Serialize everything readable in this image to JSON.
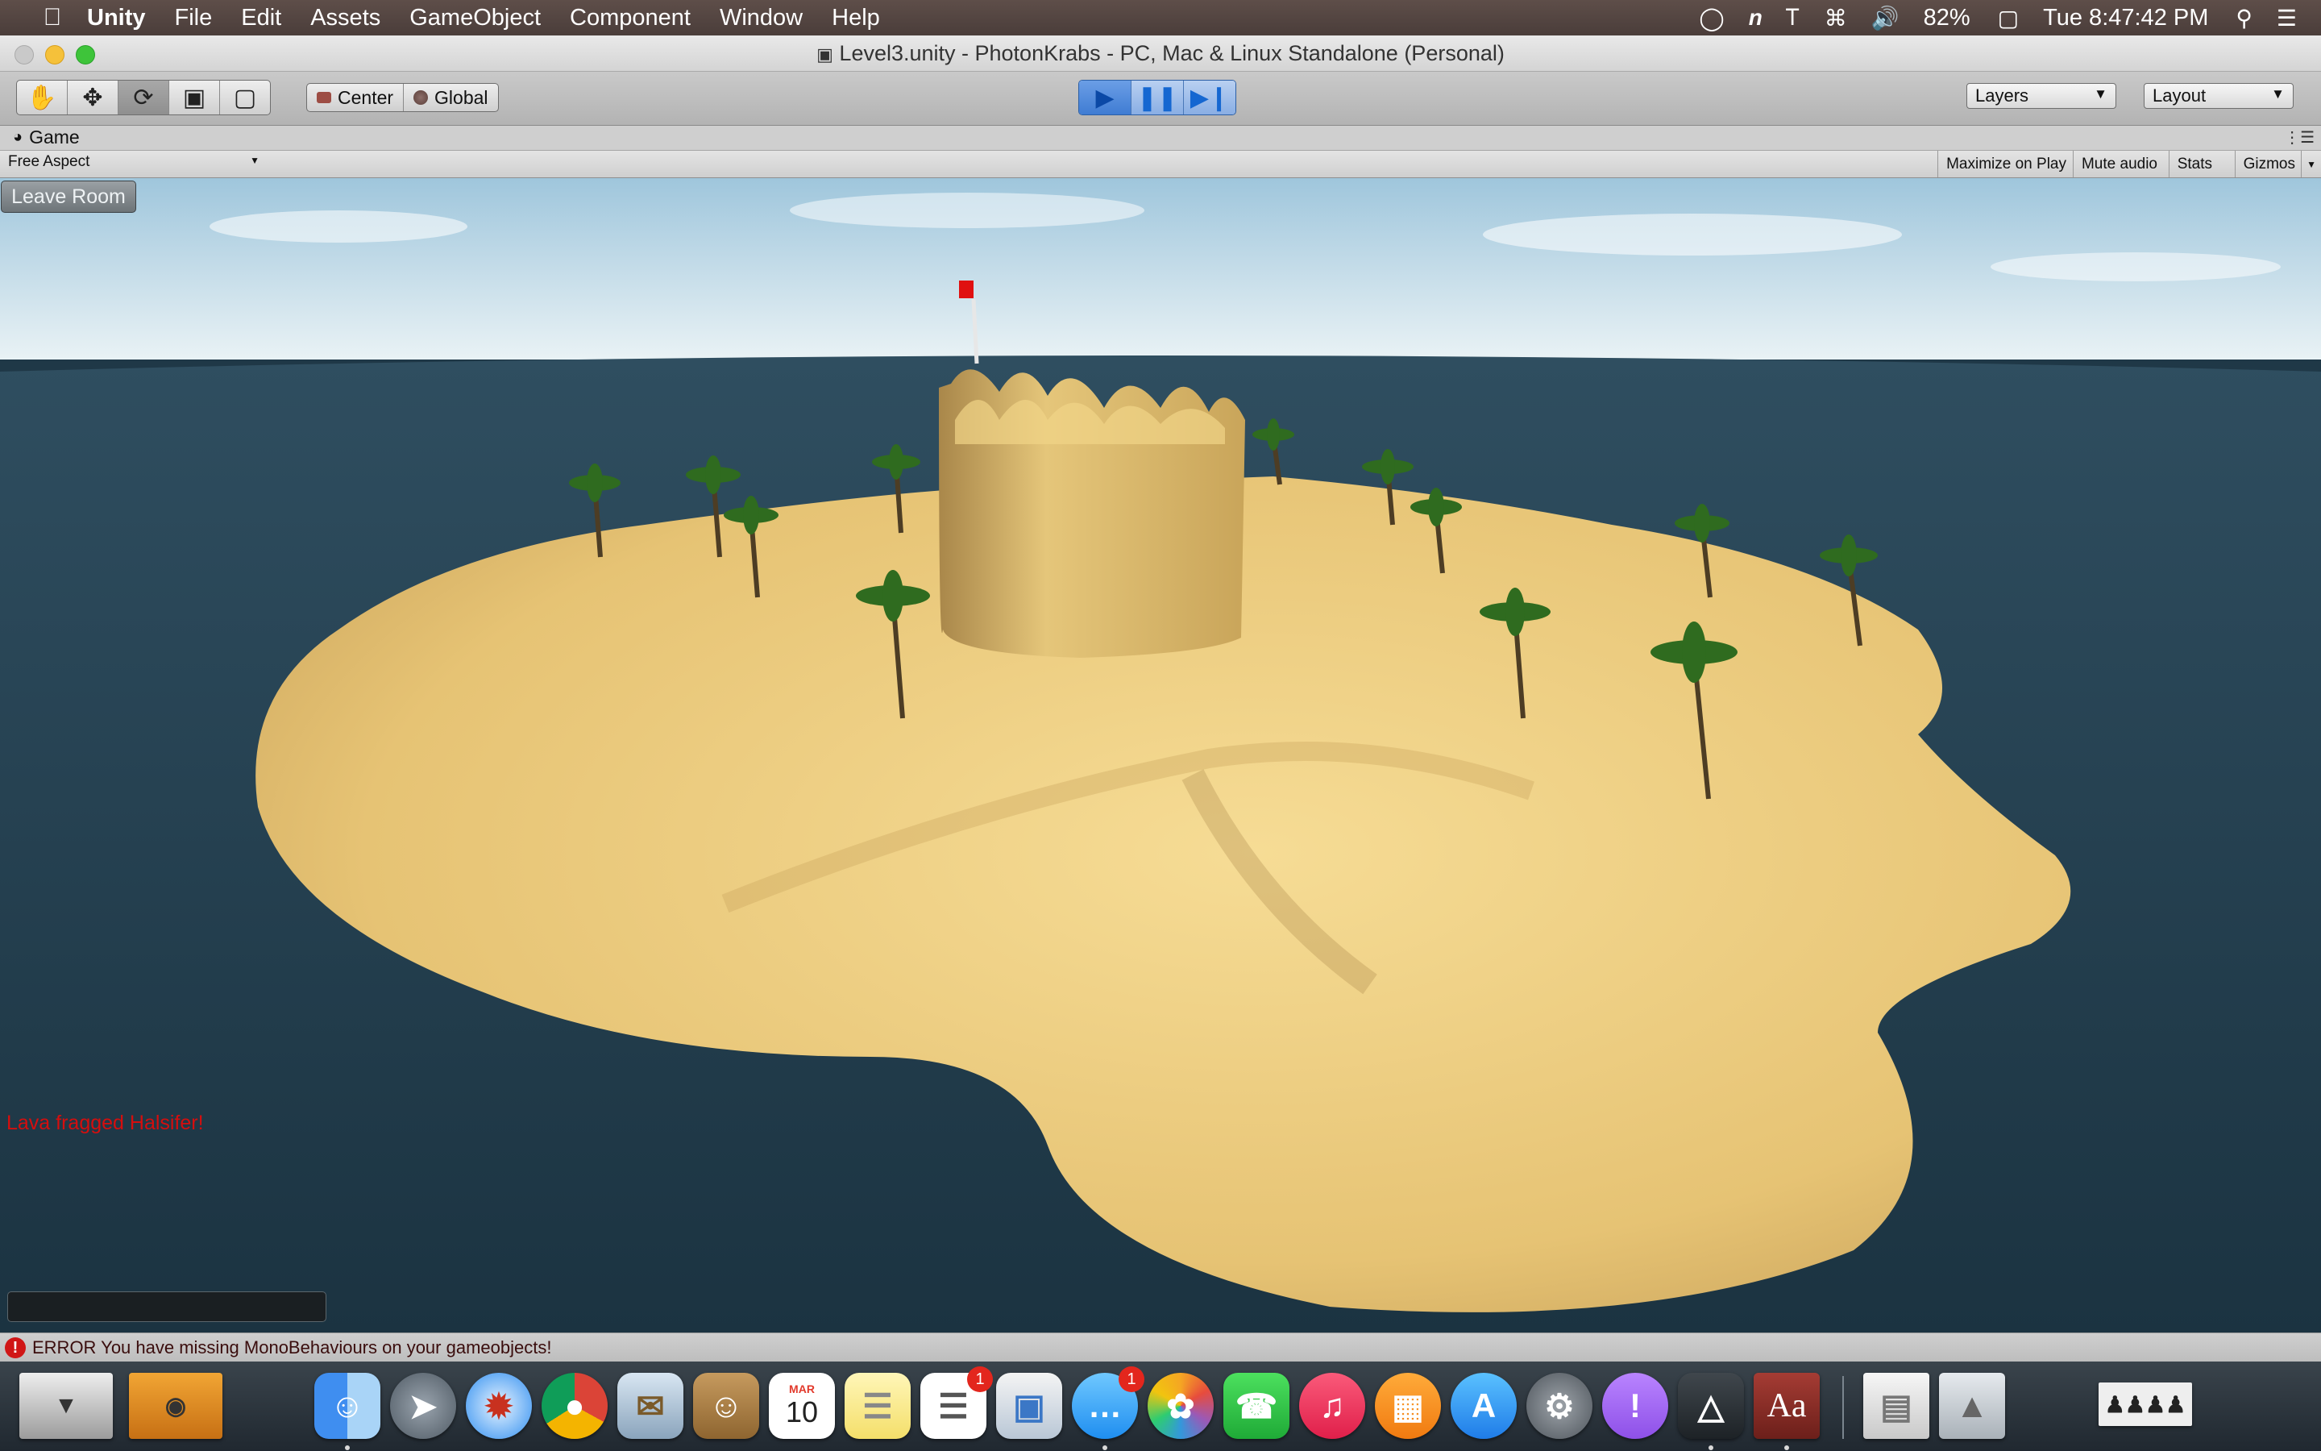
{
  "menubar": {
    "apple_icon": "apple-icon",
    "app_name": "Unity",
    "menus": [
      "File",
      "Edit",
      "Assets",
      "GameObject",
      "Component",
      "Window",
      "Help"
    ],
    "battery": "82%",
    "clock": "Tue 8:47:42 PM"
  },
  "window": {
    "title": "Level3.unity - PhotonKrabs - PC, Mac & Linux Standalone (Personal)"
  },
  "toolbar": {
    "tools": [
      "hand-icon",
      "move-icon",
      "rotate-icon",
      "scale-icon",
      "rect-icon"
    ],
    "pivot_mode": "Center",
    "pivot_rotation": "Global",
    "layers_label": "Layers",
    "layout_label": "Layout"
  },
  "game_view": {
    "tab_label": "Game",
    "aspect": "Free Aspect",
    "buttons": [
      "Maximize on Play",
      "Mute audio",
      "Stats",
      "Gizmos"
    ],
    "leave_room": "Leave Room",
    "frag_message": "Lava fragged Halsifer!",
    "chat_input": ""
  },
  "statusbar": {
    "error": "ERROR You have missing MonoBehaviours on your gameobjects!"
  },
  "dock": {
    "calendar_month": "MAR",
    "calendar_day": "10",
    "reminders_badge": "1",
    "messages_badge": "1",
    "dictionary_label": "Aa"
  },
  "colors": {
    "accent": "#1567d1",
    "error": "#d01616",
    "sand": "#e8c475",
    "sea": "#1f3847",
    "sky": "#cfe3ee"
  }
}
